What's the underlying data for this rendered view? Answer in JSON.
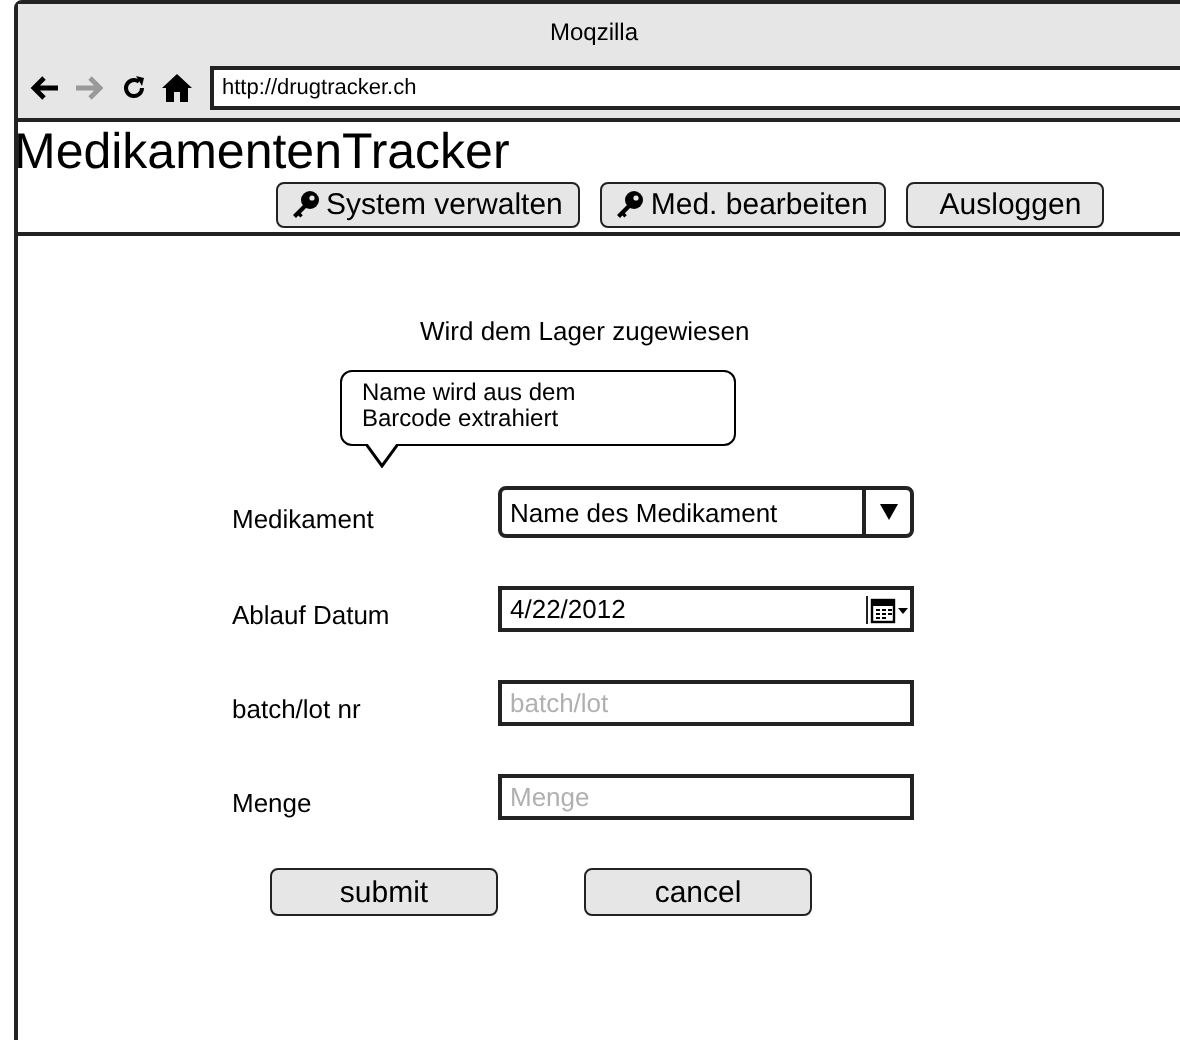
{
  "window": {
    "title": "Moqzilla"
  },
  "browser": {
    "nav": [
      {
        "kind": "back",
        "disabled": false
      },
      {
        "kind": "forward",
        "disabled": true
      },
      {
        "kind": "reload",
        "disabled": false
      },
      {
        "kind": "home",
        "disabled": false
      }
    ],
    "url": "http://drugtracker.ch"
  },
  "app": {
    "title": "MedikamentenTracker"
  },
  "toolbar": [
    {
      "label": "System verwalten",
      "kind": "key"
    },
    {
      "label": "Med. bearbeiten",
      "kind": "key"
    },
    {
      "label": "Ausloggen",
      "kind": "plain"
    }
  ],
  "form": {
    "heading": "Wird dem Lager zugewiesen",
    "callout": "Name wird aus dem Barcode extrahiert",
    "fields": [
      {
        "label": "Medikament",
        "kind": "dropdown",
        "value": "Name des Medikament"
      },
      {
        "label": "Ablauf Datum",
        "kind": "date",
        "value": "4/22/2012"
      },
      {
        "label": "batch/lot nr",
        "kind": "text",
        "placeholder": "batch/lot"
      },
      {
        "label": "Menge",
        "kind": "text",
        "placeholder": "Menge"
      }
    ],
    "buttons": [
      "submit",
      "cancel"
    ]
  }
}
